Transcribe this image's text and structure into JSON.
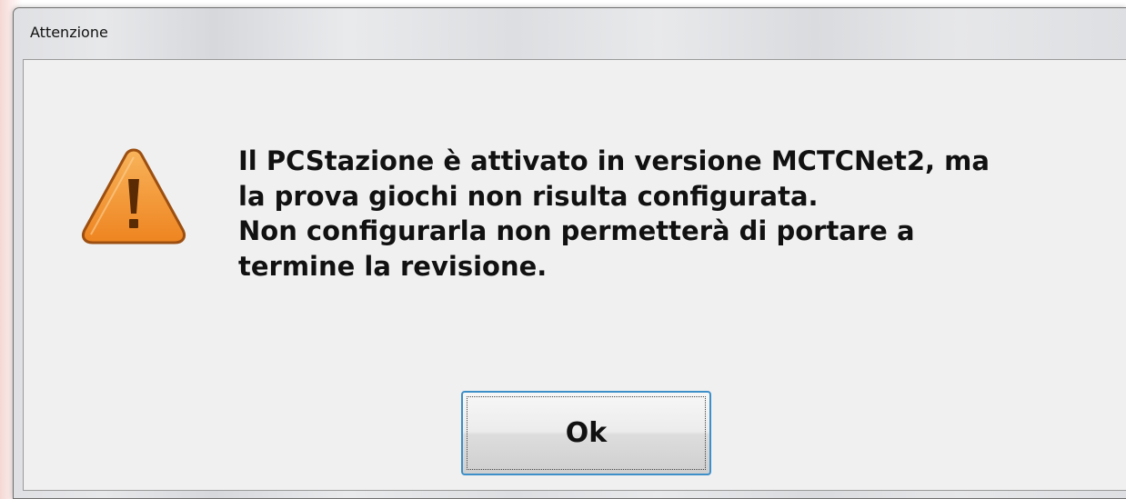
{
  "window": {
    "title": "Attenzione"
  },
  "dialog": {
    "icon": "warning-triangle-icon",
    "message_lines": [
      "Il PCStazione è attivato in versione MCTCNet2, ma",
      "la prova giochi non risulta configurata.",
      "Non configurarla non permetterà di portare a",
      "termine la revisione."
    ],
    "ok_label": "Ok"
  },
  "colors": {
    "warning_fill": "#f39a3a",
    "warning_border": "#9c4f10",
    "button_focus_border": "#3c8fc8",
    "client_background": "#f0f0f0"
  }
}
